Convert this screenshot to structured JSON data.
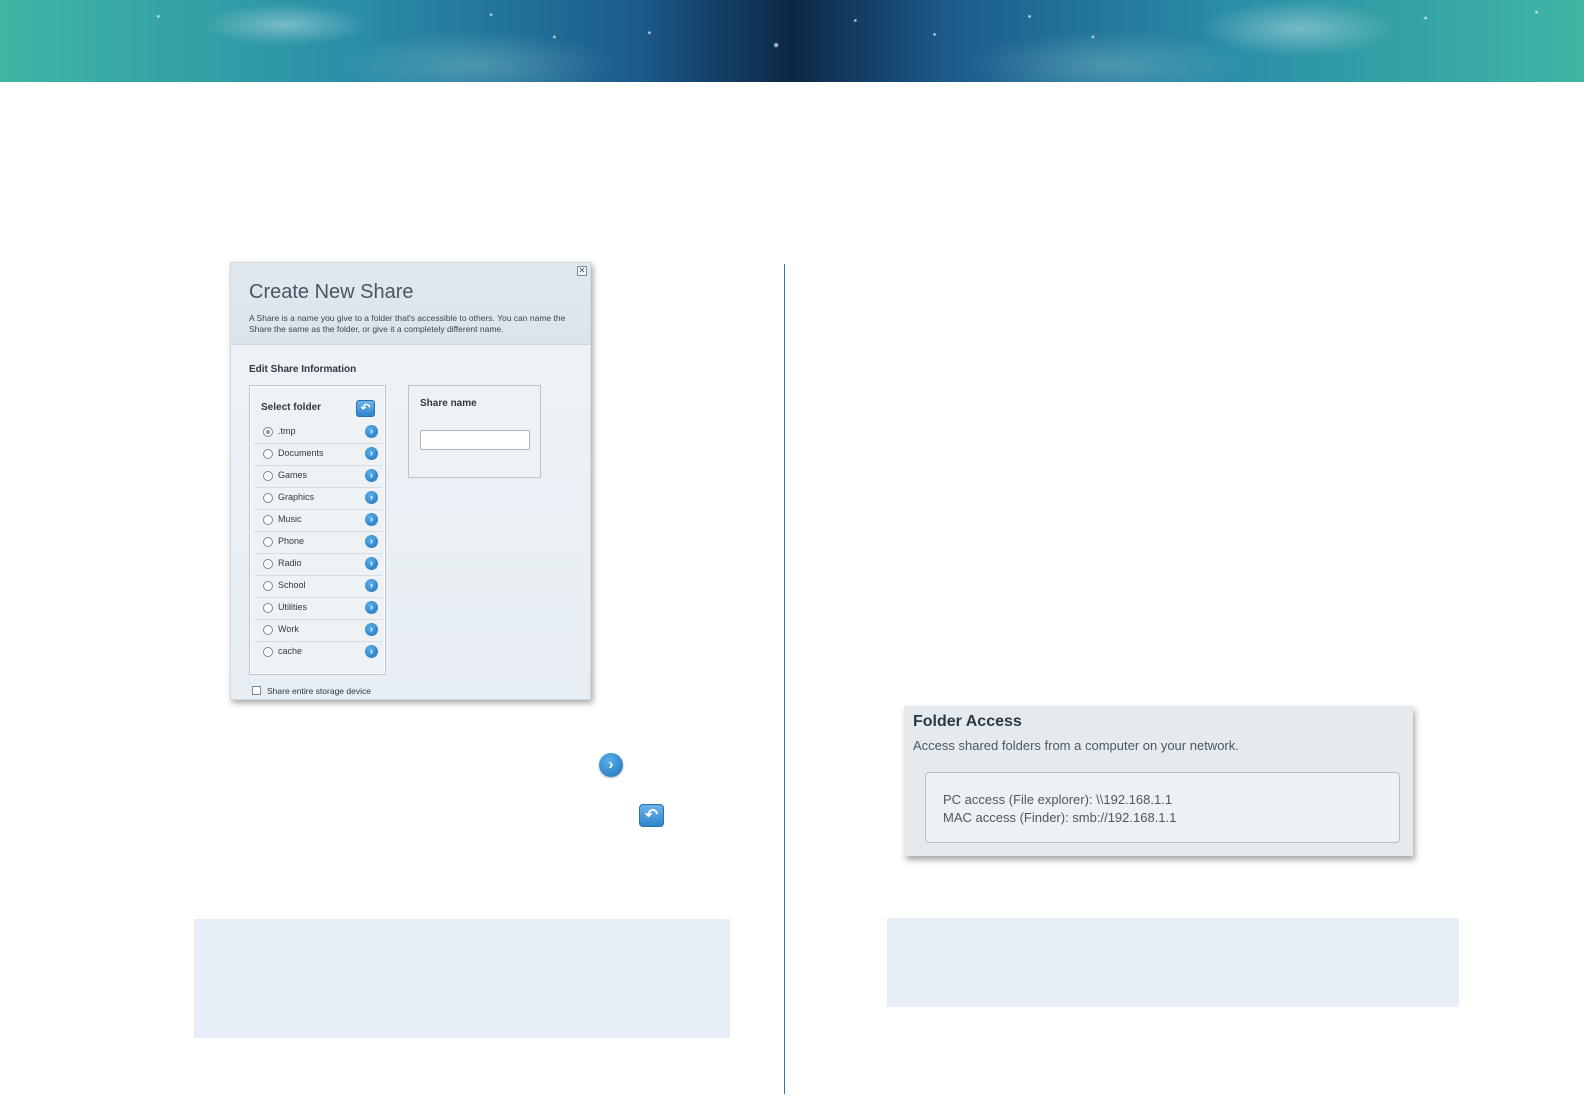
{
  "dialog": {
    "close_glyph": "✕",
    "title": "Create New Share",
    "description": "A Share is a name you give to a folder that's accessible to others. You can name the Share the same as the folder, or give it a completely different name.",
    "section_title": "Edit Share Information",
    "select_folder": {
      "title": "Select folder",
      "back_glyph": "↶",
      "items": [
        {
          "label": ".tmp",
          "selected": true
        },
        {
          "label": "Documents",
          "selected": false
        },
        {
          "label": "Games",
          "selected": false
        },
        {
          "label": "Graphics",
          "selected": false
        },
        {
          "label": "Music",
          "selected": false
        },
        {
          "label": "Phone",
          "selected": false
        },
        {
          "label": "Radio",
          "selected": false
        },
        {
          "label": "School",
          "selected": false
        },
        {
          "label": "Utilities",
          "selected": false
        },
        {
          "label": "Work",
          "selected": false
        },
        {
          "label": "cache",
          "selected": false
        }
      ]
    },
    "share_name": {
      "title": "Share name",
      "value": ""
    },
    "share_entire_label": "Share entire storage device",
    "share_entire_checked": false
  },
  "icons": {
    "arrow_glyph": "›",
    "back_glyph": "↶"
  },
  "folder_access": {
    "title": "Folder Access",
    "subtitle": "Access shared folders from a computer on your network.",
    "pc_access": "PC access (File explorer): \\\\192.168.1.1",
    "mac_access": "MAC access (Finder): smb://192.168.1.1"
  },
  "colors": {
    "accent": "#2f84cc",
    "divider": "#3d6fa3",
    "note_background": "#e8eef8"
  }
}
